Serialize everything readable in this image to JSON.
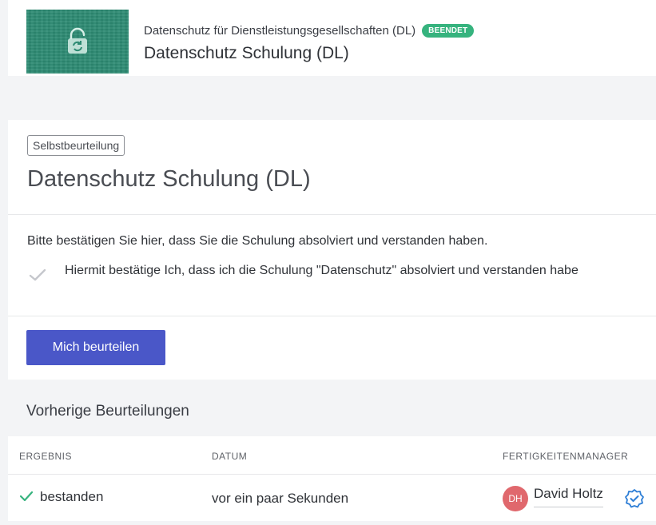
{
  "course": {
    "subtitle": "Datenschutz für Dienstleistungsgesellschaften (DL)",
    "status_badge": "BEENDET",
    "title": "Datenschutz Schulung (DL)",
    "thumbnail_icon": "lock-refresh-icon",
    "thumbnail_color": "#2c8a72"
  },
  "assessment": {
    "type_tag": "Selbstbeurteilung",
    "title": "Datenschutz Schulung (DL)",
    "instruction": "Bitte bestätigen Sie hier, dass Sie die Schulung absolviert und verstanden haben.",
    "confirmation_text": "Hiermit bestätige Ich, dass ich die Schulung \"Datenschutz\" absolviert und verstanden habe",
    "confirmation_icon": "check-icon",
    "button_label": "Mich beurteilen",
    "button_color": "#4a57c8"
  },
  "previous": {
    "title": "Vorherige Beurteilungen",
    "columns": [
      "ERGEBNIS",
      "DATUM",
      "FERTIGKEITENMANAGER"
    ],
    "rows": [
      {
        "result": "bestanden",
        "result_icon": "check-icon",
        "date": "vor ein paar Sekunden",
        "manager_initials": "DH",
        "manager_name": "David Holtz",
        "manager_badge_icon": "verified-badge-icon"
      }
    ]
  },
  "colors": {
    "success": "#36b37e",
    "avatar": "#e0686d",
    "verified": "#2f7fd6"
  }
}
